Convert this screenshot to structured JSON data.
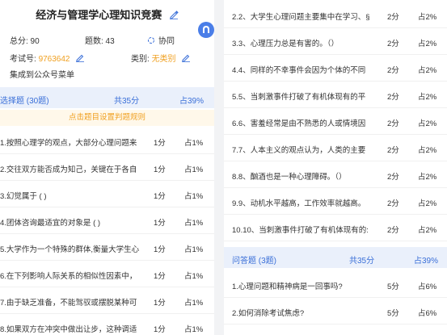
{
  "header": {
    "title": "经济与管理学心理知识竞赛",
    "total_label": "总分: 90",
    "count_label": "题数: 43",
    "coop_label": "协同",
    "exam_no_label": "考试号: ",
    "exam_no": "9763642",
    "category_label": "类别: ",
    "category": "无类别",
    "menu_label": "集成到公众号菜单"
  },
  "sections": {
    "choice": {
      "title": "选择题 (30题)",
      "score": "共35分",
      "percent": "占39%"
    },
    "rule_hint": "点击题目设置判题规则",
    "essay": {
      "title": "问答题 (3题)",
      "score": "共35分",
      "percent": "占39%"
    }
  },
  "left_questions": [
    {
      "text": "1.按照心理学的观点，大部分心理问题来",
      "score": "1分",
      "percent": "占1%"
    },
    {
      "text": "2.交往双方能否成为知己，关键在于各自",
      "score": "1分",
      "percent": "占1%"
    },
    {
      "text": "3.幻觉属于 ( )",
      "score": "1分",
      "percent": "占1%"
    },
    {
      "text": "4.团体咨询最适宜的对象是 ( )",
      "score": "1分",
      "percent": "占1%"
    },
    {
      "text": "5.大学作为一个特殊的群体,衡量大学生心",
      "score": "1分",
      "percent": "占1%"
    },
    {
      "text": "6.在下列影响人际关系的相似性因素中，",
      "score": "1分",
      "percent": "占1%"
    },
    {
      "text": "7.由于缺乏准备，不能驾驭或摆脱某种可",
      "score": "1分",
      "percent": "占1%"
    },
    {
      "text": "8.如果双方在冲突中做出让步，这种调适",
      "score": "1分",
      "percent": "占1%"
    }
  ],
  "right_questions": [
    {
      "text": "2.2、大学生心理问题主要集中在学习、§",
      "score": "2分",
      "percent": "占2%"
    },
    {
      "text": "3.3、心理压力总是有害的。（）",
      "score": "2分",
      "percent": "占2%"
    },
    {
      "text": "4.4、同样的不幸事件会因为个体的不同",
      "score": "2分",
      "percent": "占2%"
    },
    {
      "text": "5.5、当刺激事件打破了有机体现有的平",
      "score": "2分",
      "percent": "占2%"
    },
    {
      "text": "6.6、害羞经常是由不熟悉的人或情境因",
      "score": "2分",
      "percent": "占2%"
    },
    {
      "text": "7.7、人本主义的观点认为，人类的主要",
      "score": "2分",
      "percent": "占2%"
    },
    {
      "text": "8.8、酗酒也是一种心理障碍。（）",
      "score": "2分",
      "percent": "占2%"
    },
    {
      "text": "9.9、动机水平越高，工作效率就越高。",
      "score": "2分",
      "percent": "占2%"
    },
    {
      "text": "10.10、当刺激事件打破了有机体现有的:",
      "score": "2分",
      "percent": "占2%"
    }
  ],
  "essay_questions": [
    {
      "text": "1.心理问题和精神病是一回事吗?",
      "score": "5分",
      "percent": "占6%"
    },
    {
      "text": "2.如何消除考试焦虑?",
      "score": "5分",
      "percent": "占6%"
    }
  ]
}
